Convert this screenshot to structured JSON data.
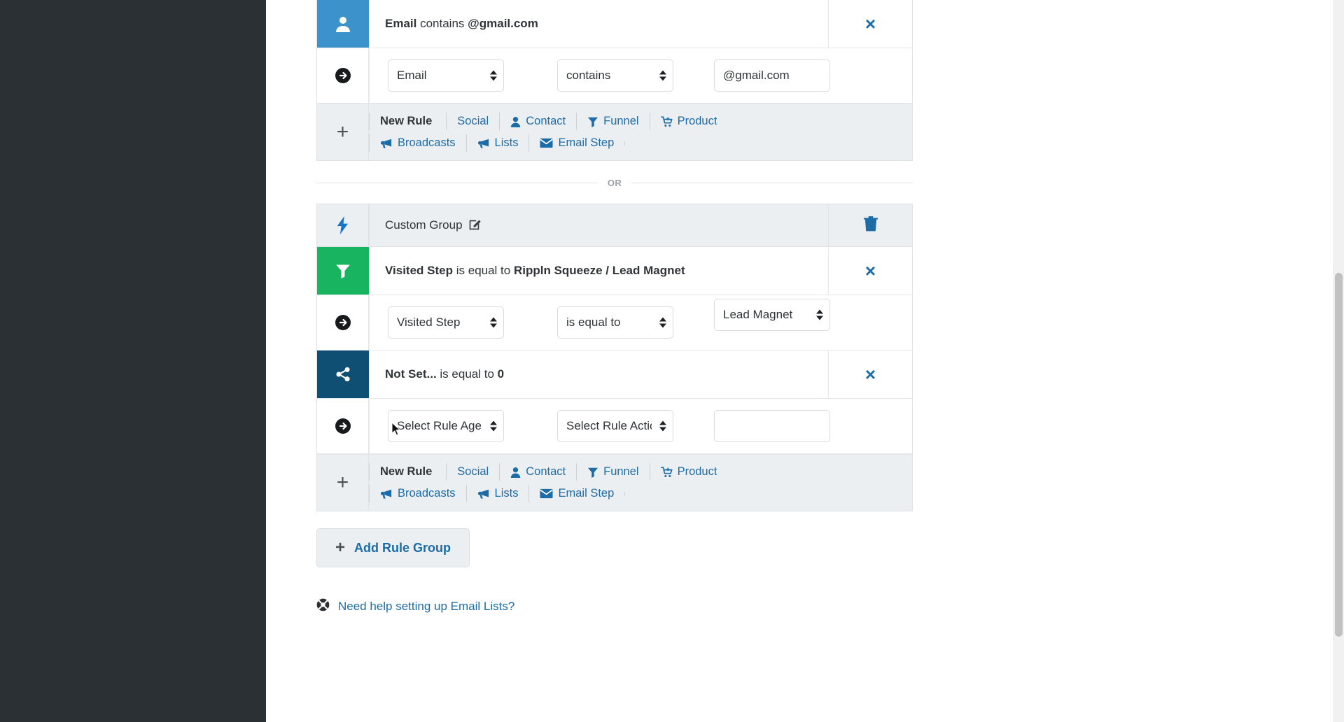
{
  "groups": [
    {
      "id": "group-1",
      "has_header": false,
      "rules": [
        {
          "icon": "contact-person-icon",
          "icon_color": "#3c92ca",
          "summary": {
            "subject": "Email",
            "operator": "contains",
            "value": "@gmail.com"
          },
          "remove_label": "×",
          "editor": {
            "agent_value": "Email",
            "agent_options": [
              "Email"
            ],
            "action_value": "contains",
            "action_options": [
              "contains"
            ],
            "value_value": "@gmail.com",
            "value_placeholder": "",
            "value_is_select": false
          }
        }
      ],
      "new_rule": {
        "label": "New Rule",
        "line1": [
          {
            "text": "Social",
            "icon": ""
          },
          {
            "text": "Contact",
            "icon": "person-icon"
          },
          {
            "text": "Funnel",
            "icon": "funnel-icon"
          },
          {
            "text": "Product",
            "icon": "cart-plus-icon"
          }
        ],
        "line2": [
          {
            "text": "Broadcasts",
            "icon": "megaphone-icon"
          },
          {
            "text": "Lists",
            "icon": "megaphone-icon"
          },
          {
            "text": "Email Step",
            "icon": "envelope-icon"
          }
        ]
      }
    },
    {
      "id": "group-2",
      "has_header": true,
      "header": {
        "title": "Custom Group",
        "icon": "lightning-bolt-icon",
        "edit_icon": "edit-pencil-icon",
        "delete_icon": "trash-icon"
      },
      "rules": [
        {
          "icon": "funnel-icon",
          "icon_color": "#18b460",
          "summary": {
            "subject": "Visited Step",
            "operator": "is equal to",
            "value": "Rippln Squeeze / Lead Magnet"
          },
          "remove_label": "×",
          "editor": {
            "agent_value": "Visited Step",
            "agent_options": [
              "Visited Step"
            ],
            "action_value": "is equal to",
            "action_options": [
              "is equal to"
            ],
            "value_value": "Lead Magnet",
            "value_placeholder": "",
            "value_is_select": true
          }
        },
        {
          "icon": "share-alt-icon",
          "icon_color": "#0e4f73",
          "summary": {
            "subject": "Not Set...",
            "operator": "is equal to",
            "value": "0"
          },
          "remove_label": "×",
          "editor": {
            "agent_value": "Select Rule Agent",
            "agent_options": [
              "Select Rule Agent"
            ],
            "action_value": "Select Rule Action",
            "action_options": [
              "Select Rule Action"
            ],
            "value_value": "",
            "value_placeholder": "",
            "value_is_select": false
          }
        }
      ],
      "new_rule": {
        "label": "New Rule",
        "line1": [
          {
            "text": "Social",
            "icon": ""
          },
          {
            "text": "Contact",
            "icon": "person-icon"
          },
          {
            "text": "Funnel",
            "icon": "funnel-icon"
          },
          {
            "text": "Product",
            "icon": "cart-plus-icon"
          }
        ],
        "line2": [
          {
            "text": "Broadcasts",
            "icon": "megaphone-icon"
          },
          {
            "text": "Lists",
            "icon": "megaphone-icon"
          },
          {
            "text": "Email Step",
            "icon": "envelope-icon"
          }
        ]
      }
    }
  ],
  "divider": {
    "or_label": "OR"
  },
  "add_rule_group": {
    "label": "Add Rule Group",
    "plus": "+"
  },
  "help": {
    "label": "Need help setting up Email Lists?",
    "icon": "lifering-icon"
  },
  "colors": {
    "link_blue": "#1c6ca8",
    "contact_blue": "#3c92ca",
    "funnel_green": "#18b460",
    "share_navy": "#0e4f73",
    "panel_grey": "#eceff1",
    "rail_dark": "#2b3034"
  }
}
